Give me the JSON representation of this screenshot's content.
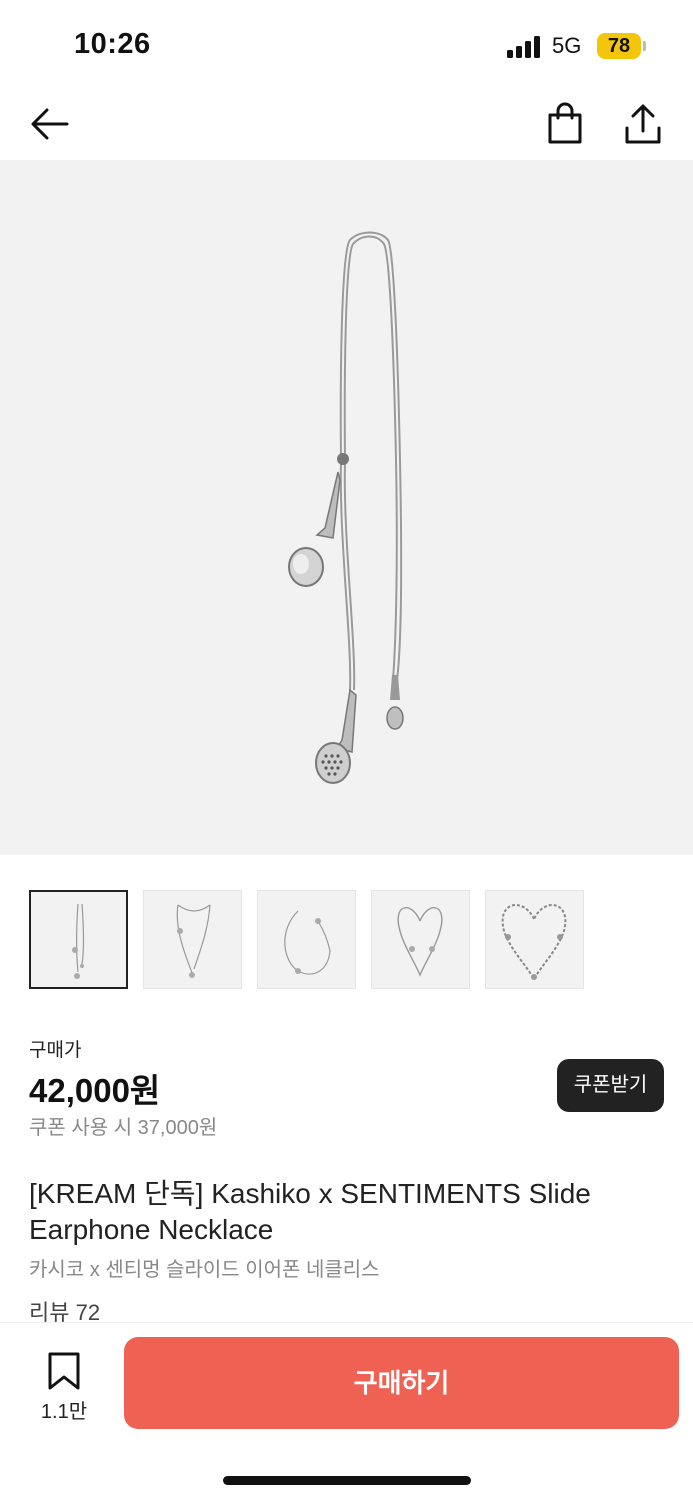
{
  "status_bar": {
    "time": "10:26",
    "network": "5G",
    "battery": "78",
    "battery_color": "#f4c60a"
  },
  "nav": {
    "back_icon": "arrow-left-icon",
    "bag_icon": "shopping-bag-icon",
    "share_icon": "share-icon"
  },
  "product": {
    "price_label": "구매가",
    "price": "42,000원",
    "coupon_price": "쿠폰 사용 시 37,000원",
    "coupon_button": "쿠폰받기",
    "title": "[KREAM 단독] Kashiko x SENTIMENTS Slide Earphone Necklace",
    "subtitle": "카시코 x 센티멍 슬라이드 이어폰 네클리스",
    "review_link": "리뷰 72"
  },
  "thumbnails": {
    "count": 5,
    "selected_index": 0
  },
  "bottom_bar": {
    "bookmark_count": "1.1만",
    "buy_button": "구매하기",
    "buy_color": "#ef6253"
  }
}
